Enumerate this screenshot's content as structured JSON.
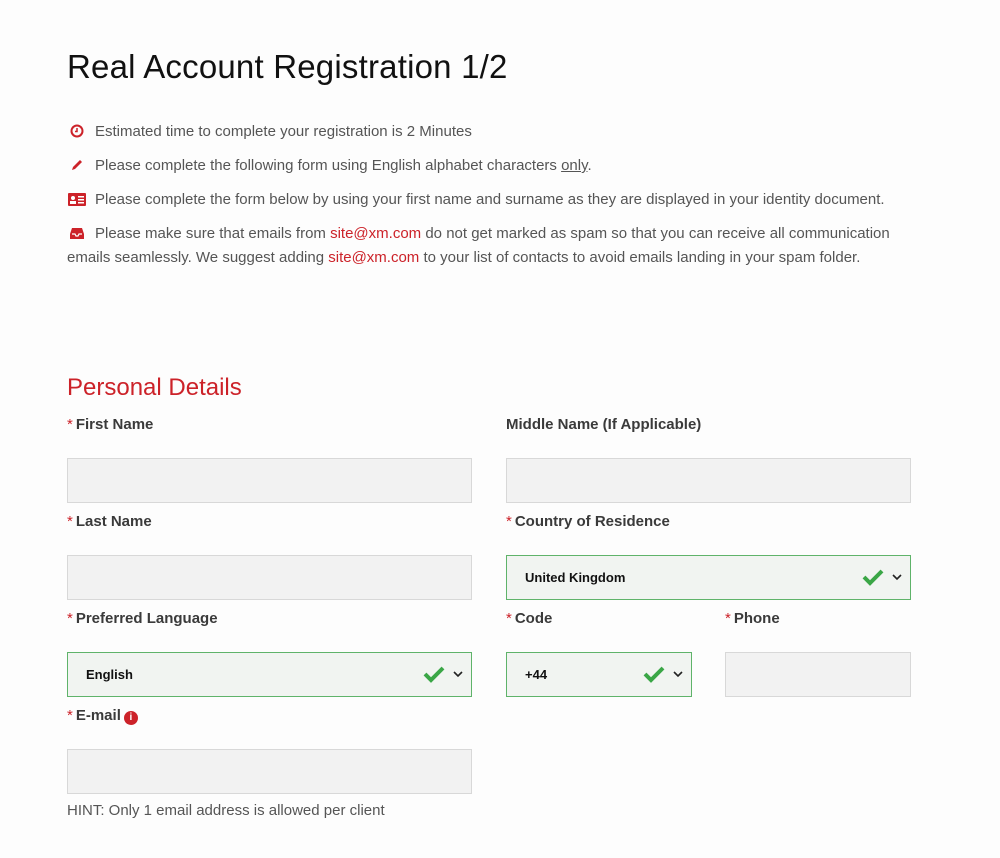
{
  "page": {
    "title": "Real Account Registration 1/2",
    "accent_color": "#cc2229",
    "success_color": "#3aa646"
  },
  "notes": [
    {
      "icon": "clock-icon",
      "text": "Estimated time to complete your registration is 2 Minutes"
    },
    {
      "icon": "pencil-icon",
      "text_before": "Please complete the following form using English alphabet characters ",
      "underlined": "only",
      "text_after": "."
    },
    {
      "icon": "id-card-icon",
      "text": "Please complete the form below by using your first name and surname as they are displayed in your identity document."
    },
    {
      "icon": "inbox-icon",
      "t1": "Please make sure that emails from ",
      "email": "site@xm.com",
      "t2": " do not get marked as spam so that you can receive all communication emails seamlessly. We suggest adding ",
      "t3": " to your list of contacts to avoid emails landing in your spam folder."
    }
  ],
  "section": {
    "title": "Personal Details"
  },
  "fields": {
    "first_name": {
      "label": "First Name",
      "required": "*",
      "value": ""
    },
    "middle_name": {
      "label": "Middle Name (If Applicable)",
      "value": ""
    },
    "last_name": {
      "label": "Last Name",
      "required": "*",
      "value": ""
    },
    "country": {
      "label": "Country of Residence",
      "required": "*",
      "value": "United Kingdom"
    },
    "language": {
      "label": "Preferred Language",
      "required": "*",
      "value": "English"
    },
    "code": {
      "label": "Code",
      "required": "*",
      "value": "+44"
    },
    "phone": {
      "label": "Phone",
      "required": "*",
      "value": ""
    },
    "email": {
      "label": "E-mail",
      "required": "*",
      "value": "",
      "info_icon": "i"
    }
  },
  "hint": "HINT: Only 1 email address is allowed per client"
}
